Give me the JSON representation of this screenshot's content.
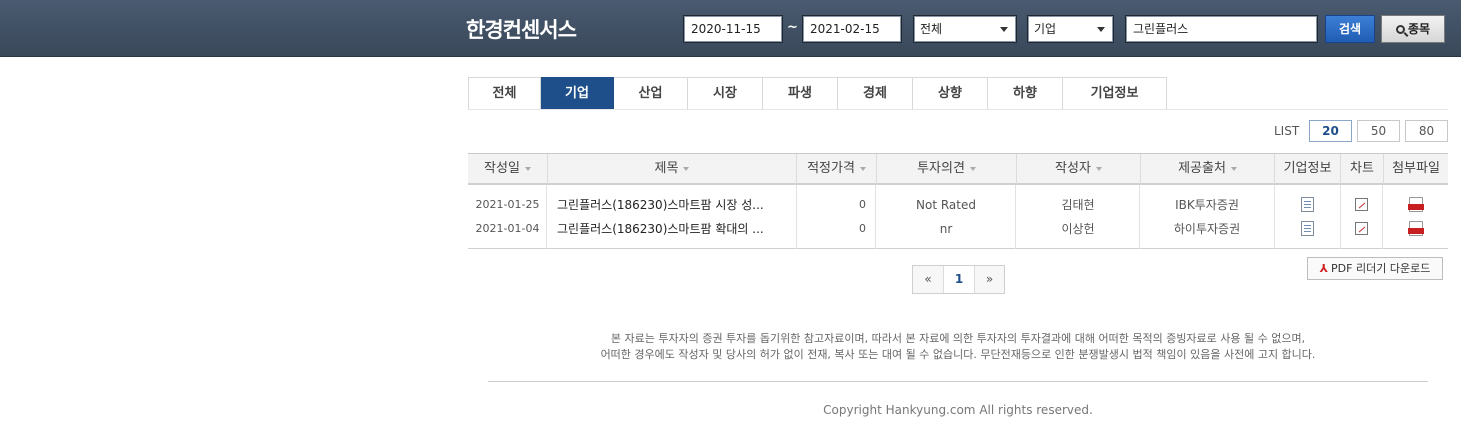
{
  "header": {
    "brand": "한경컨센서스",
    "start_date": "2020-11-15",
    "separator": "~",
    "end_date": "2021-02-15",
    "select_scope": "전체",
    "select_category": "기업",
    "keyword": "그린플러스",
    "search_label": "검색",
    "stock_label": "종목"
  },
  "tabs": [
    "전체",
    "기업",
    "산업",
    "시장",
    "파생",
    "경제",
    "상향",
    "하향",
    "기업정보"
  ],
  "active_tab": 1,
  "list": {
    "label": "LIST",
    "options": [
      "20",
      "50",
      "80"
    ],
    "selected": "20"
  },
  "table": {
    "columns": [
      "작성일",
      "제목",
      "적정가격",
      "투자의견",
      "작성자",
      "제공출처",
      "기업정보",
      "차트",
      "첨부파일"
    ],
    "rows": [
      {
        "date": "2021-01-25",
        "title": "그린플러스(186230)스마트팜 시장 성...",
        "price": "0",
        "opinion": "Not Rated",
        "author": "김태현",
        "source": "IBK투자증권",
        "info_icon": "document-icon",
        "chart_icon": "chart-icon",
        "file_icon": "pdf-icon"
      },
      {
        "date": "2021-01-04",
        "title": "그린플러스(186230)스마트팜 확대의 ...",
        "price": "0",
        "opinion": "nr",
        "author": "이상헌",
        "source": "하이투자증권",
        "info_icon": "document-icon",
        "chart_icon": "chart-icon",
        "file_icon": "pdf-icon"
      }
    ]
  },
  "pdf_download": "PDF 리더기 다운로드",
  "pagination": {
    "prev": "«",
    "current": "1",
    "next": "»"
  },
  "notice": {
    "line1": "본 자료는 투자자의 증권 투자를 돕기위한 참고자료이며, 따라서 본 자료에 의한 투자자의 투자결과에 대해 어떠한 목적의 증빙자료로 사용 될 수 없으며,",
    "line2": "어떠한 경우에도 작성자 및 당사의 허가 없이 전재, 복사 또는 대여 될 수 없습니다. 무단전재등으로 인한 분쟁발생시 법적 책임이 있음을 사전에 고지 합니다."
  },
  "copyright": "Copyright Hankyung.com All rights reserved.",
  "colors": {
    "header_bg": "#3f4e62",
    "tab_active": "#1e4f8a",
    "search_button": "#2a6bc4"
  }
}
